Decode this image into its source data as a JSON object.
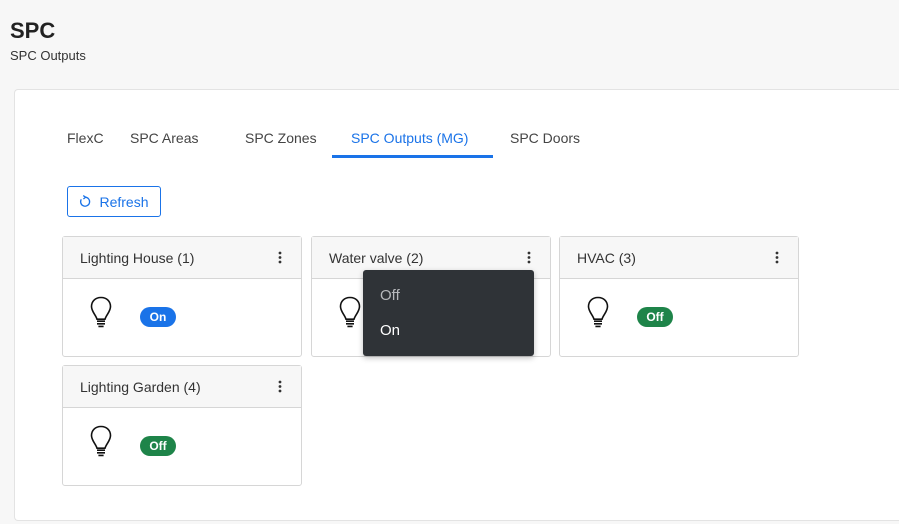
{
  "header": {
    "title": "SPC",
    "subtitle": "SPC Outputs"
  },
  "tabs": [
    {
      "label": "FlexC"
    },
    {
      "label": "SPC Areas"
    },
    {
      "label": "SPC Zones"
    },
    {
      "label": "SPC Outputs (MG)",
      "active": true
    },
    {
      "label": "SPC Doors"
    }
  ],
  "toolbar": {
    "refresh_label": "Refresh",
    "refresh_icon": "refresh-icon"
  },
  "outputs": [
    {
      "name": "Lighting House (1)",
      "icon": "lightbulb-icon",
      "state": "On",
      "state_color": "#1a73e8"
    },
    {
      "name": "Water valve (2)",
      "icon": "lightbulb-icon",
      "state": "",
      "state_color": ""
    },
    {
      "name": "HVAC (3)",
      "icon": "lightbulb-icon",
      "state": "Off",
      "state_color": "#1e8449"
    },
    {
      "name": "Lighting Garden (4)",
      "icon": "lightbulb-icon",
      "state": "Off",
      "state_color": "#1e8449"
    }
  ],
  "menu": {
    "items": [
      {
        "label": "Off"
      },
      {
        "label": "On"
      }
    ]
  },
  "colors": {
    "accent": "#1a73e8",
    "off_badge": "#1e8449",
    "menu_bg": "#2f3337"
  }
}
